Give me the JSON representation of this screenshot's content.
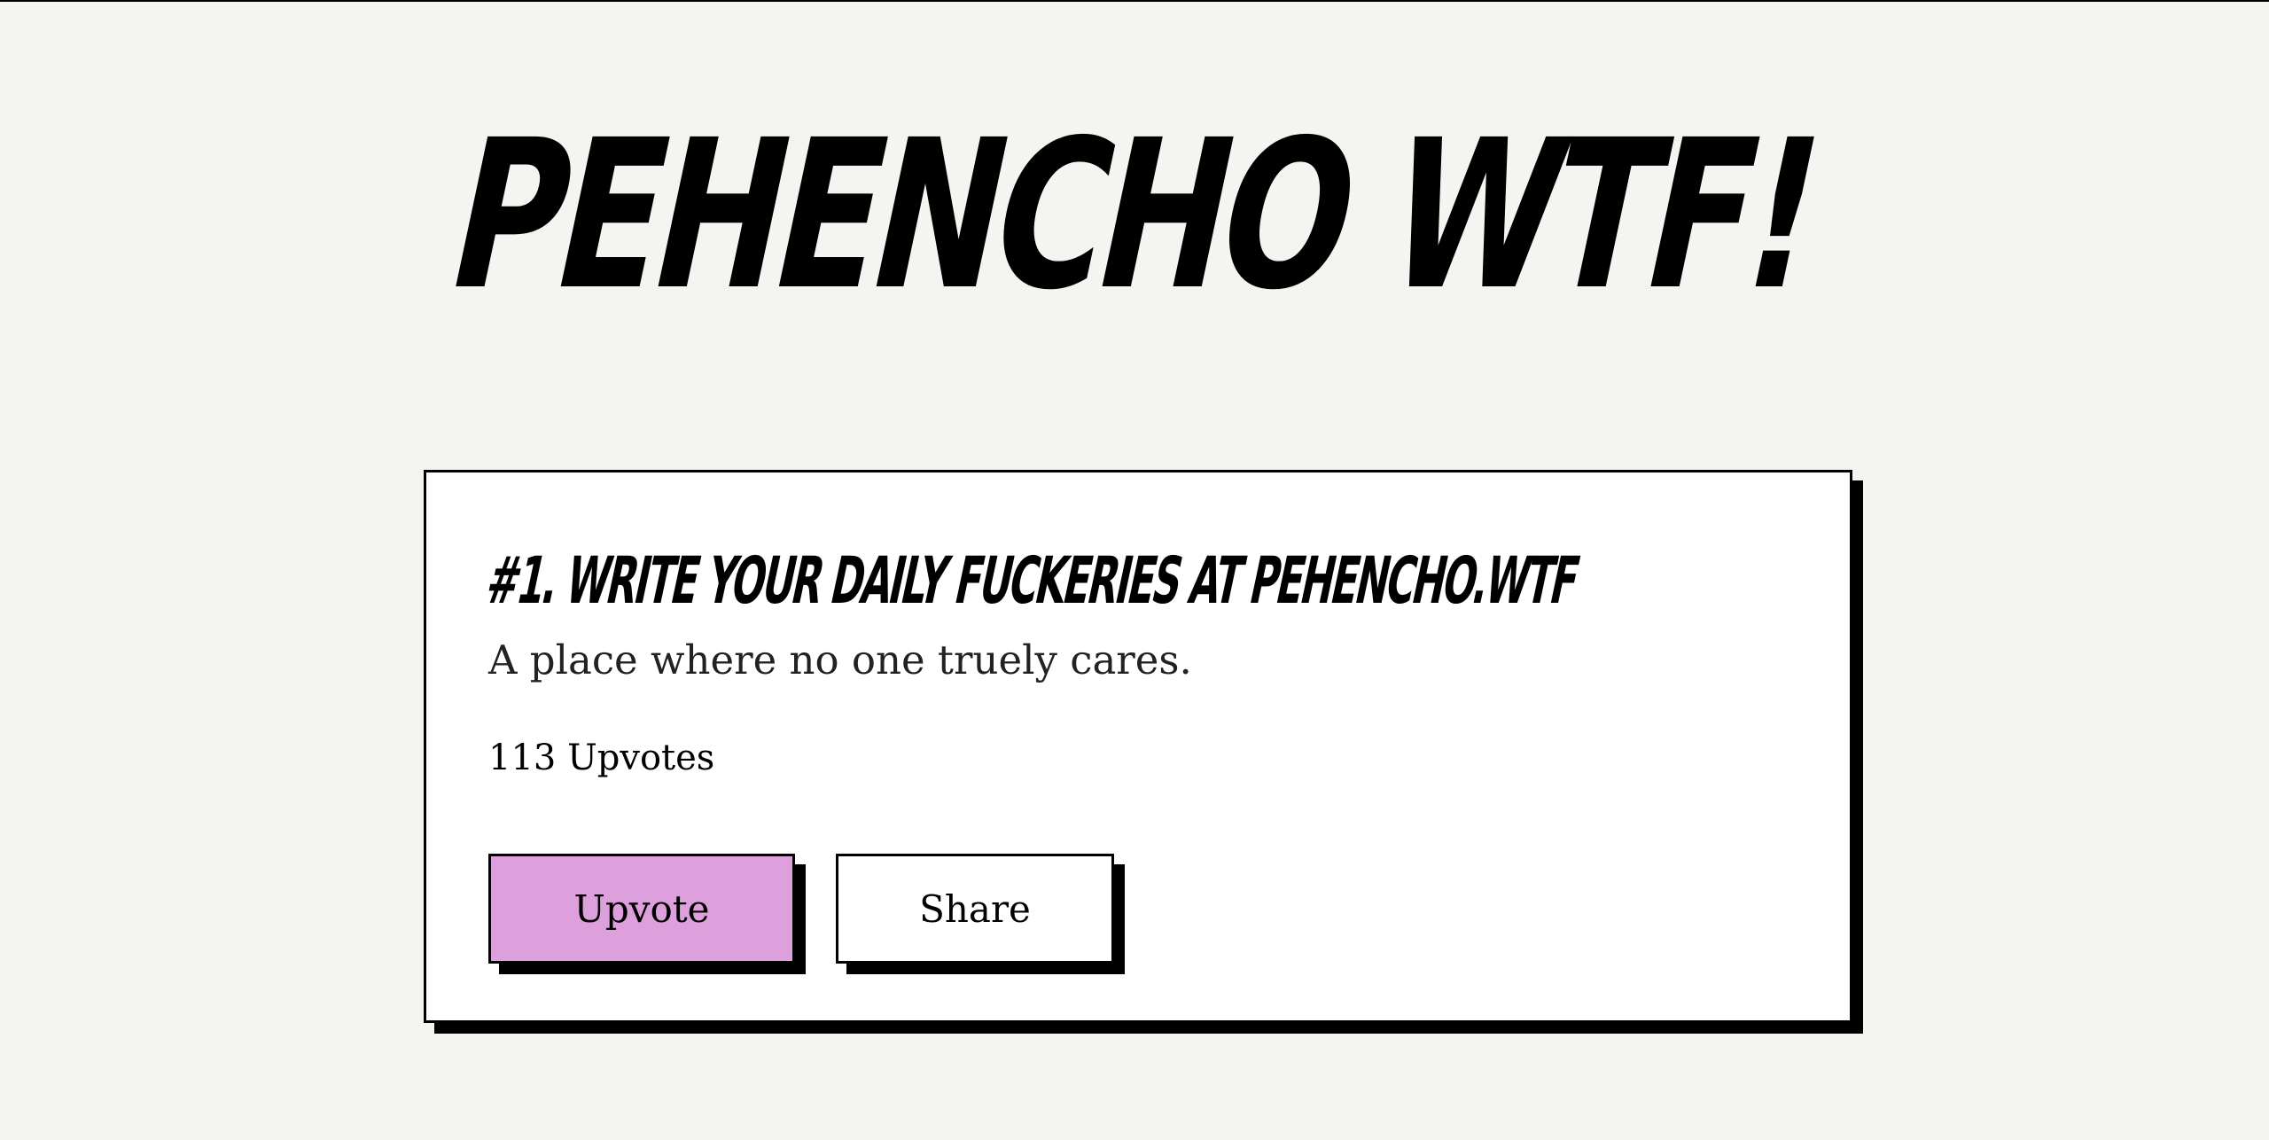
{
  "site": {
    "title": "PEHENCHO WTF!"
  },
  "post": {
    "title": "#1. WRITE YOUR DAILY FUCKERIES AT PEHENCHO.WTF",
    "description": "A place where no one truely cares.",
    "upvotes_text": "113 Upvotes"
  },
  "actions": {
    "upvote_label": "Upvote",
    "share_label": "Share"
  },
  "colors": {
    "background": "#f4f4f0",
    "card": "#ffffff",
    "upvote_button": "#dda0dd",
    "border": "#000000"
  }
}
